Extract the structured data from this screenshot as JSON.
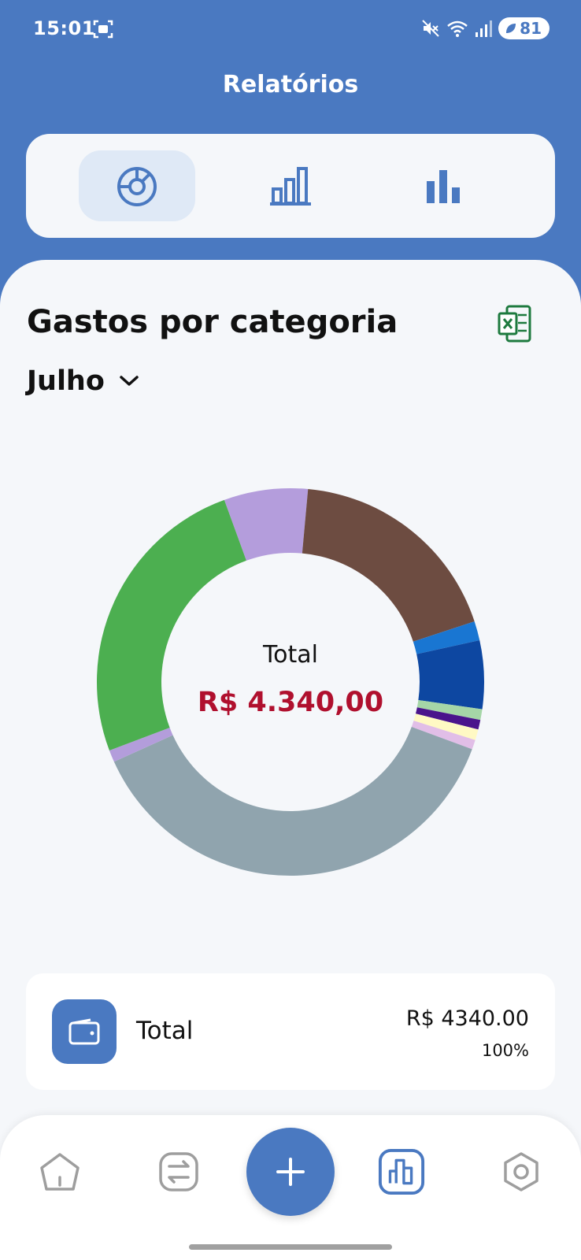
{
  "status_bar": {
    "time": "15:01",
    "battery": "81"
  },
  "header": {
    "title": "Relatórios"
  },
  "report_tabs": [
    {
      "icon": "donut-chart-icon",
      "active": true
    },
    {
      "icon": "bar-chart-outline-icon",
      "active": false
    },
    {
      "icon": "bar-chart-solid-icon",
      "active": false
    }
  ],
  "section": {
    "title": "Gastos por categoria",
    "month": "Julho"
  },
  "chart_data": {
    "type": "pie",
    "donut": true,
    "center_label": "Total",
    "center_value": "R$ 4.340,00",
    "slices": [
      {
        "value": 7.0,
        "color": "#b49ddc"
      },
      {
        "value": 18.5,
        "color": "#6d4c41"
      },
      {
        "value": 1.6,
        "color": "#1976d2"
      },
      {
        "value": 5.7,
        "color": "#0d47a1"
      },
      {
        "value": 0.9,
        "color": "#a5d6a7"
      },
      {
        "value": 0.8,
        "color": "#4a148c"
      },
      {
        "value": 0.9,
        "color": "#fff9c4"
      },
      {
        "value": 0.8,
        "color": "#e1bee7"
      },
      {
        "value": 37.6,
        "color": "#90a4ae"
      },
      {
        "value": 1.0,
        "color": "#b39ddb"
      },
      {
        "value": 25.2,
        "color": "#4caf50"
      }
    ]
  },
  "summary": {
    "label": "Total",
    "amount": "R$ 4340.00",
    "percent": "100%"
  },
  "colors": {
    "primary": "#4a79c1",
    "total_value": "#b0102e",
    "excel_green": "#1d7a3e"
  },
  "bottom_nav": [
    "home-icon",
    "transactions-icon",
    "add-icon",
    "reports-icon",
    "settings-icon"
  ]
}
